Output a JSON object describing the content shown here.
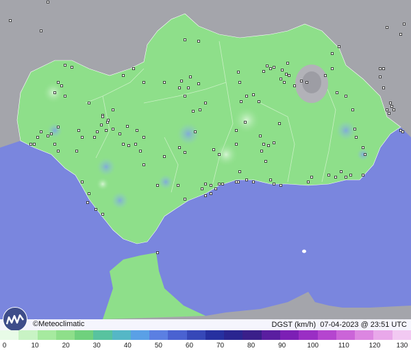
{
  "map": {
    "stations_count_note": "",
    "colors": {
      "sea": "#7a86de",
      "land_region": "#8edf8a",
      "land_outside": "#a9a9ad",
      "border": "#ffffff"
    }
  },
  "footer": {
    "brand": "©Meteoclimatic",
    "variable": "DGST (km/h)",
    "timestamp": "07-04-2023 @ 23:51 UTC"
  },
  "scale": {
    "labels": [
      "0",
      "10",
      "20",
      "30",
      "40",
      "50",
      "60",
      "70",
      "80",
      "90",
      "100",
      "110",
      "120",
      "130"
    ],
    "colors": [
      "#e8fbe7",
      "#c8f3c4",
      "#a6ea9f",
      "#8edf8a",
      "#6fd17d",
      "#58c39f",
      "#55b7c6",
      "#5aa0e6",
      "#5b7fe2",
      "#4a62d1",
      "#3648b8",
      "#2630a0",
      "#2a2590",
      "#3a1f8a",
      "#5a1ea0",
      "#7c1fb5",
      "#9a2ec4",
      "#b545cf",
      "#cb64d8",
      "#dc86e1",
      "#e9a8ea",
      "#f2c9f2"
    ]
  }
}
